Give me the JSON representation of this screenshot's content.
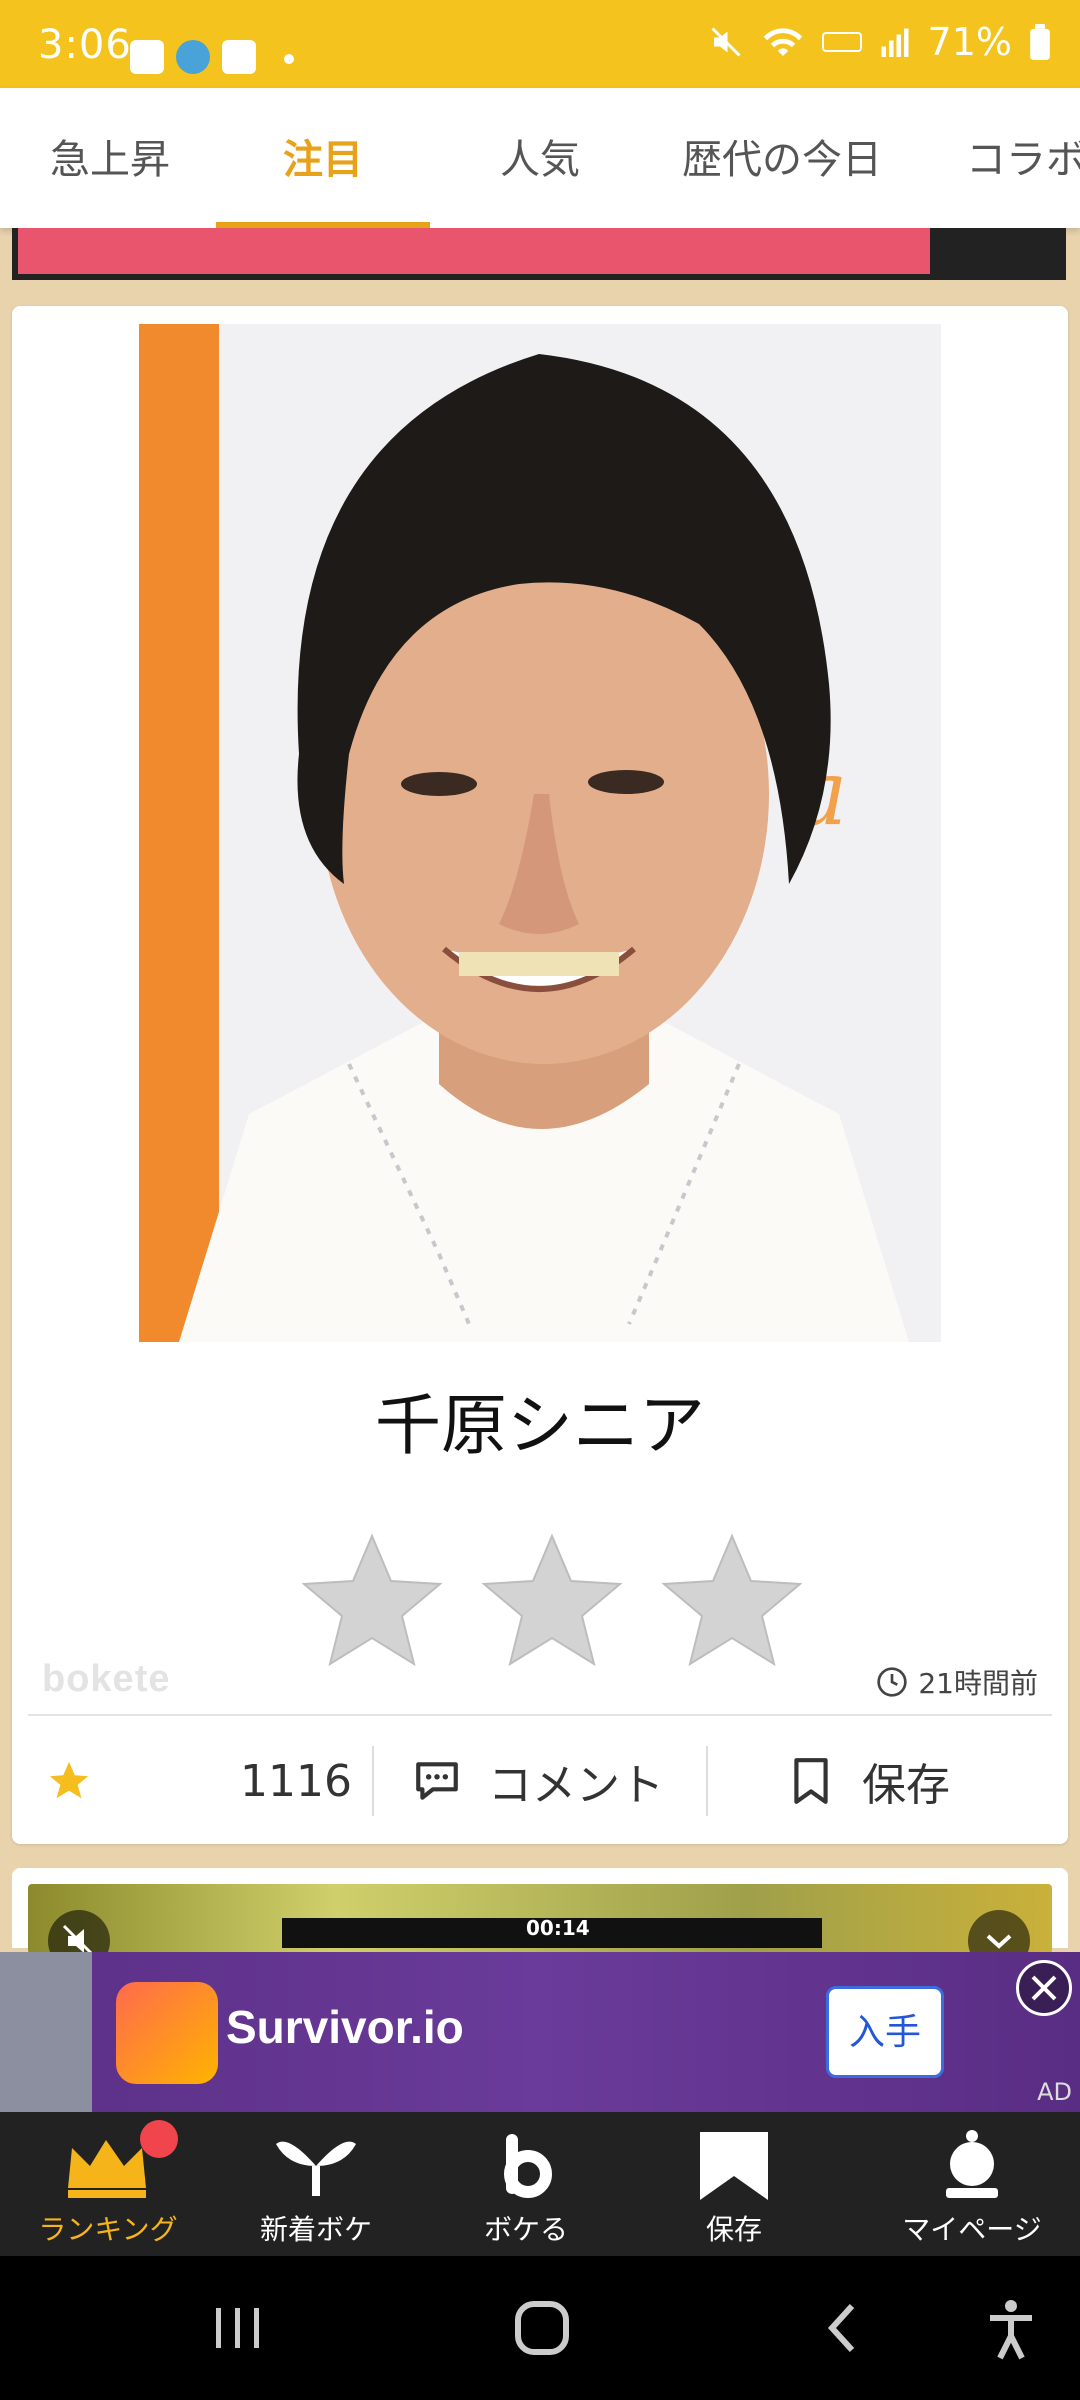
{
  "status_bar": {
    "time": "3:06",
    "battery": "71%"
  },
  "tabs": [
    {
      "label": "急上昇"
    },
    {
      "label": "注目"
    },
    {
      "label": "人気"
    },
    {
      "label": "歴代の今日"
    },
    {
      "label": "コラボ"
    }
  ],
  "active_tab": "注目",
  "post": {
    "caption": "千原シニア",
    "photo_text": "a",
    "watermark": "bokete",
    "time_ago": "21時間前",
    "rating_stars": 3,
    "favorite_count": "1116",
    "comment_label": "コメント",
    "save_label": "保存"
  },
  "video": {
    "time": "00:14"
  },
  "ad": {
    "app_name": "Survivor.io",
    "get_label": "入手",
    "ad_label": "AD"
  },
  "bottom_nav": [
    {
      "label": "ランキング",
      "icon": "crown-icon"
    },
    {
      "label": "新着ボケ",
      "icon": "sprout-icon"
    },
    {
      "label": "ボケる",
      "icon": "b-logo-icon"
    },
    {
      "label": "保存",
      "icon": "bookmark-icon"
    },
    {
      "label": "マイページ",
      "icon": "user-icon"
    }
  ],
  "colors": {
    "accent": "#F5C31D",
    "tab_active": "#E8A21A",
    "nav_bg": "#222222",
    "badge": "#F0454D"
  }
}
